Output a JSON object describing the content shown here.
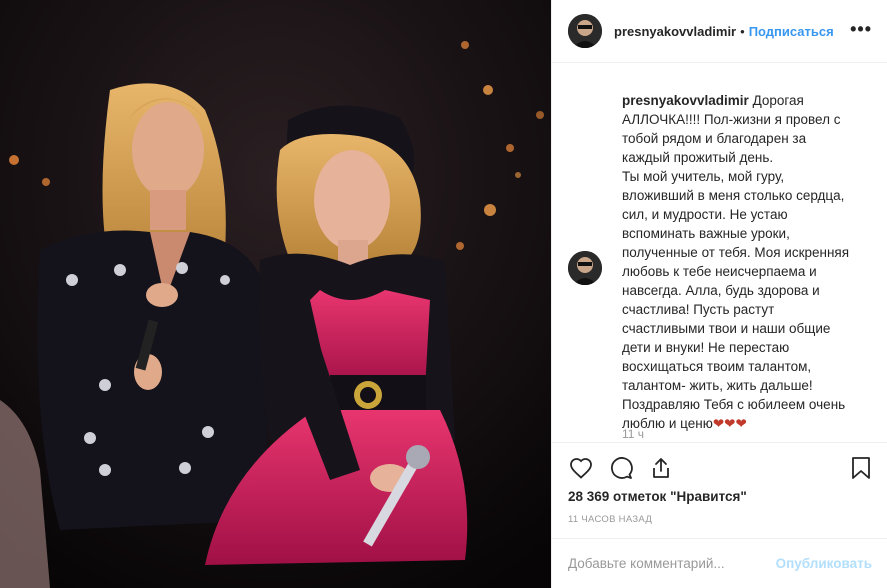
{
  "post": {
    "image_alt": "Фото на сцене",
    "author": "presnyakovvladimir",
    "separator": "•",
    "follow_label": "Подписаться",
    "more_label": "•••",
    "caption_user": "presnyakovvladimir",
    "caption_text": " Дорогая АЛЛОЧКА!!!! Пол-жизни я провел с тобой рядом и благодарен за каждый прожитый день.\nТы мой учитель, мой гуру, вложивший в меня столько сердца, сил, и мудрости. Не устаю вспоминать важные уроки, полученные от тебя. Моя искренняя любовь к тебе неисчерпаема и навсегда. Алла, будь здорова и счастлива! Пусть растут счастливыми твои и наши общие дети и внуки! Не перестаю восхищаться твоим талантом, талантом- жить, жить дальше! Поздравляю Тебя с юбилеем очень люблю и ценю",
    "caption_hearts": "❤❤❤",
    "caption_time": "11 ч",
    "likes": "28 369 отметок \"Нравится\"",
    "timestamp": "11 часов назад",
    "comment_placeholder": "Добавьте комментарий...",
    "publish_label": "Опубликовать"
  },
  "icons": {
    "like": "heart-outline-icon",
    "comment": "speech-bubble-icon",
    "share": "share-arrow-icon",
    "save": "bookmark-icon"
  },
  "colors": {
    "link_blue": "#3897f0",
    "publish_disabled": "#b2dffc",
    "muted": "#999999",
    "border": "#efefef",
    "text": "#262626",
    "heart_red": "#c0392b"
  }
}
